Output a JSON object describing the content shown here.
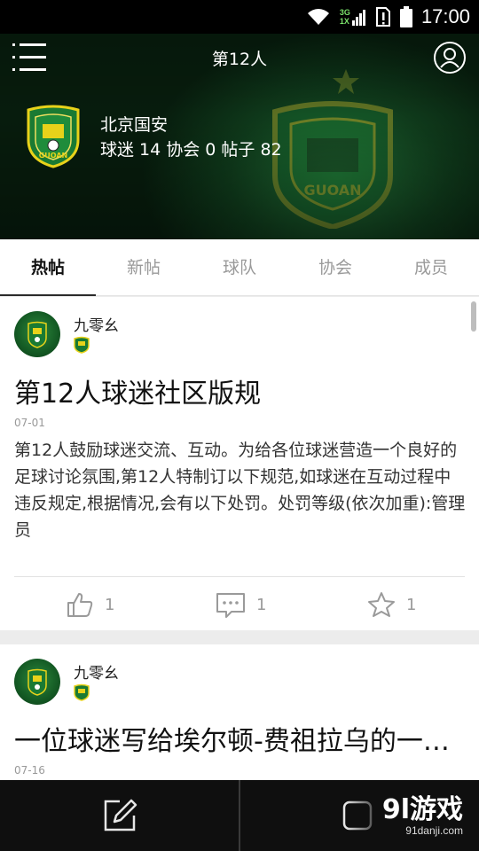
{
  "status_bar": {
    "time": "17:00",
    "network_top": "3G",
    "network_bottom": "1X"
  },
  "header": {
    "title": "第12人",
    "team_name": "北京国安",
    "team_stats": "球迷 14  协会 0  帖子 82"
  },
  "tabs": [
    {
      "label": "热帖",
      "active": true
    },
    {
      "label": "新帖",
      "active": false
    },
    {
      "label": "球队",
      "active": false
    },
    {
      "label": "协会",
      "active": false
    },
    {
      "label": "成员",
      "active": false
    }
  ],
  "posts": [
    {
      "author": "九零幺",
      "title": "第12人球迷社区版规",
      "date": "07-01",
      "excerpt": "第12人鼓励球迷交流、互动。为给各位球迷营造一个良好的足球讨论氛围,第12人特制订以下规范,如球迷在互动过程中违反规定,根据情况,会有以下处罚。处罚等级(依次加重):管理员",
      "likes": "1",
      "comments": "1",
      "favorites": "1"
    },
    {
      "author": "九零幺",
      "title": "一位球迷写给埃尔顿-费祖拉乌的一封信",
      "date": "07-16"
    }
  ],
  "watermark": {
    "logo": "9l游戏",
    "url": "91danji.com"
  },
  "colors": {
    "header_green": "#0f3a1b",
    "team_green": "#1a7a33",
    "team_yellow": "#e8d21a"
  }
}
